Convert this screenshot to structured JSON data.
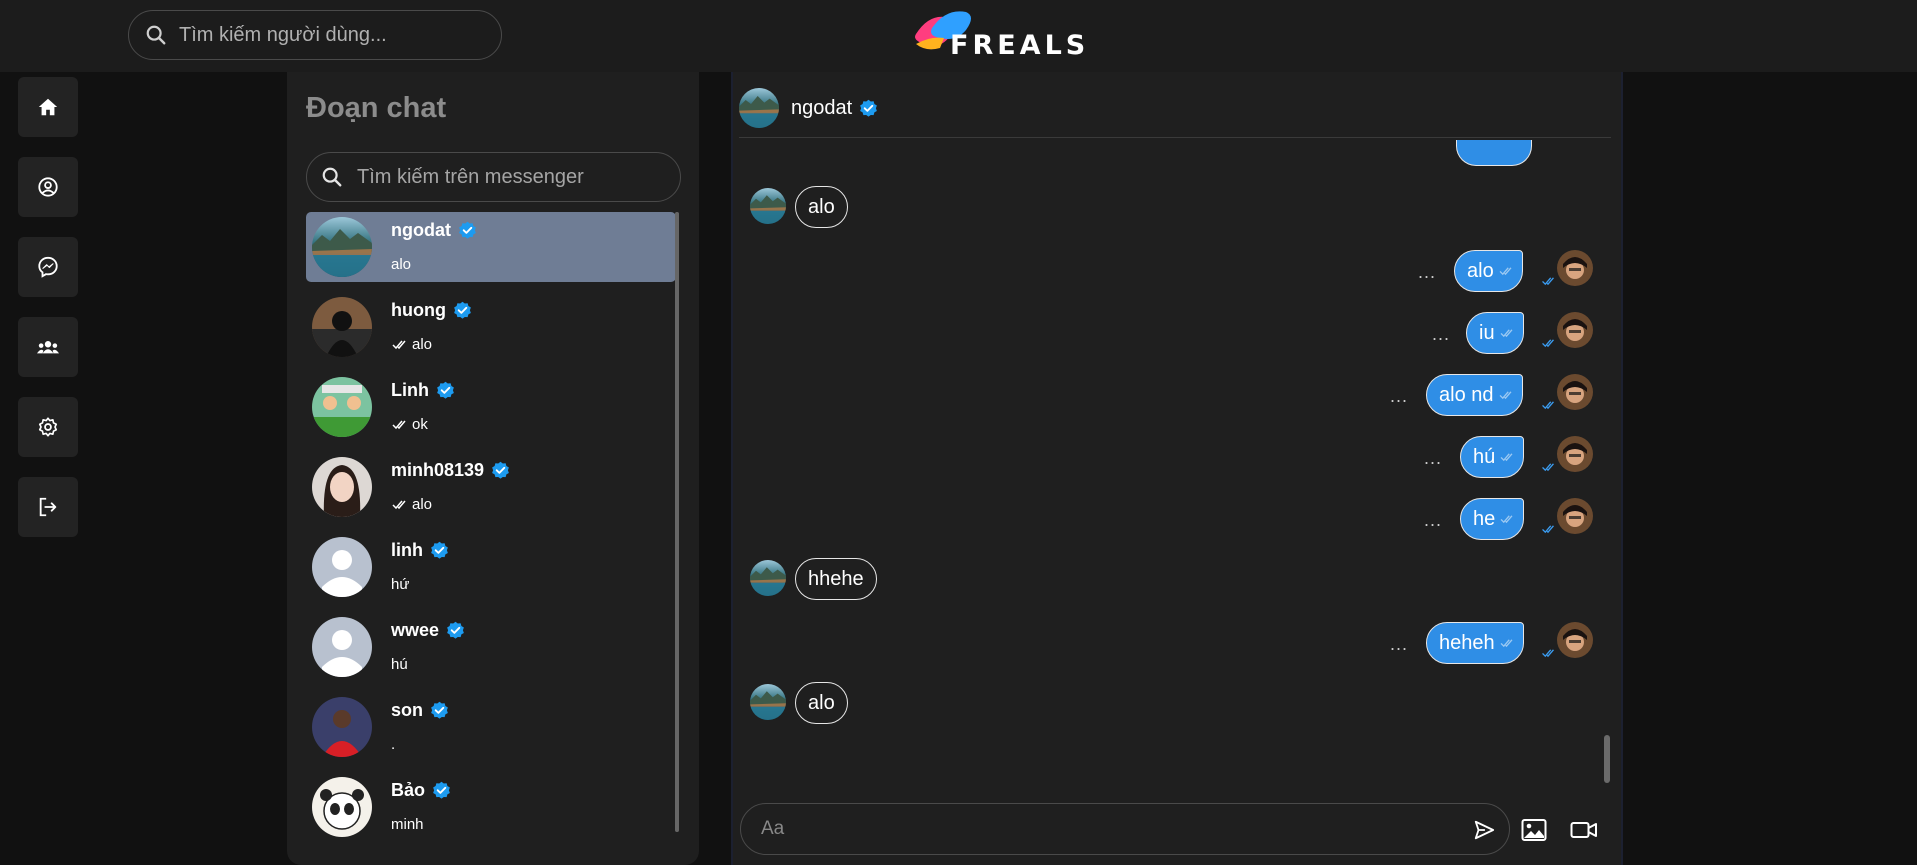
{
  "topbar": {
    "search_placeholder": "Tìm kiếm người dùng...",
    "brand": "FREALS"
  },
  "rail": [
    {
      "icon": "home-icon"
    },
    {
      "icon": "profile-icon"
    },
    {
      "icon": "messenger-icon"
    },
    {
      "icon": "groups-icon"
    },
    {
      "icon": "settings-icon"
    },
    {
      "icon": "logout-icon"
    }
  ],
  "sidebar": {
    "title": "Đoạn chat",
    "search_placeholder": "Tìm kiếm trên messenger",
    "conversations": [
      {
        "name": "ngodat",
        "last": "alo",
        "seen": false,
        "active": true
      },
      {
        "name": "huong",
        "last": "alo",
        "seen": true,
        "active": false
      },
      {
        "name": "Linh",
        "last": "ok",
        "seen": true,
        "active": false
      },
      {
        "name": "minh08139",
        "last": "alo",
        "seen": true,
        "active": false
      },
      {
        "name": "linh",
        "last": "hứ",
        "seen": false,
        "active": false
      },
      {
        "name": "wwee",
        "last": "hú",
        "seen": false,
        "active": false
      },
      {
        "name": "son",
        "last": ".",
        "seen": false,
        "active": false
      },
      {
        "name": "Bảo",
        "last": "minh",
        "seen": false,
        "active": false
      }
    ]
  },
  "chat": {
    "contact_name": "ngodat",
    "messages": [
      {
        "dir": "in",
        "text": "alo"
      },
      {
        "dir": "out",
        "text": "alo"
      },
      {
        "dir": "out",
        "text": "iu"
      },
      {
        "dir": "out",
        "text": "alo nd"
      },
      {
        "dir": "out",
        "text": "hú"
      },
      {
        "dir": "out",
        "text": "he"
      },
      {
        "dir": "in",
        "text": "hhehe"
      },
      {
        "dir": "out",
        "text": "heheh"
      },
      {
        "dir": "in",
        "text": "alo"
      }
    ],
    "more_label": "...",
    "composer_placeholder": "Aa"
  },
  "colors": {
    "bg": "#111111",
    "panel": "#1f1f1f",
    "accent": "#2f8ee6",
    "active_row": "#6f7d95",
    "verified": "#1d9bf0"
  }
}
